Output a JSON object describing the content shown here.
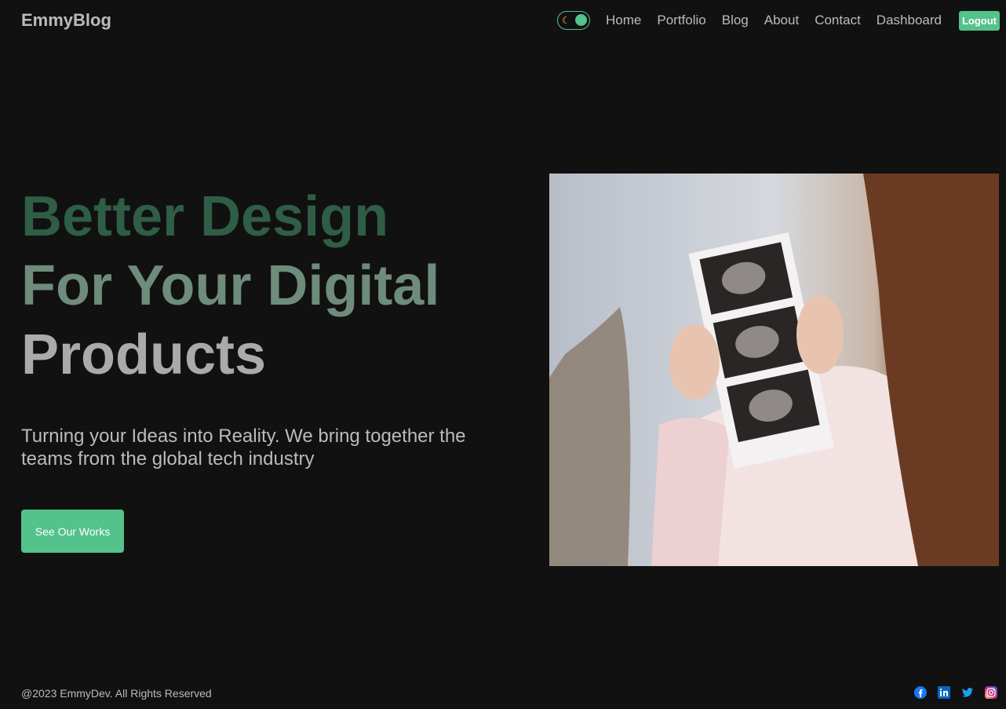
{
  "nav": {
    "logo": "EmmyBlog",
    "links": [
      "Home",
      "Portfolio",
      "Blog",
      "About",
      "Contact",
      "Dashboard"
    ],
    "logout": "Logout",
    "theme_toggle_icon": "moon-icon"
  },
  "hero": {
    "title_lines": [
      "Better Design",
      "For Your Digital",
      "Products"
    ],
    "description": "Turning your Ideas into Reality. We bring together the teams from the global tech industry",
    "cta_label": "See Our Works",
    "image_alt": "Woman holding ultrasound photos"
  },
  "footer": {
    "copyright": "@2023 EmmyDev. All Rights Reserved",
    "social_icons": [
      "facebook-icon",
      "linkedin-icon",
      "twitter-icon",
      "instagram-icon"
    ]
  },
  "colors": {
    "background": "#111111",
    "accent": "#53c28b",
    "text": "#bbbbbb"
  }
}
